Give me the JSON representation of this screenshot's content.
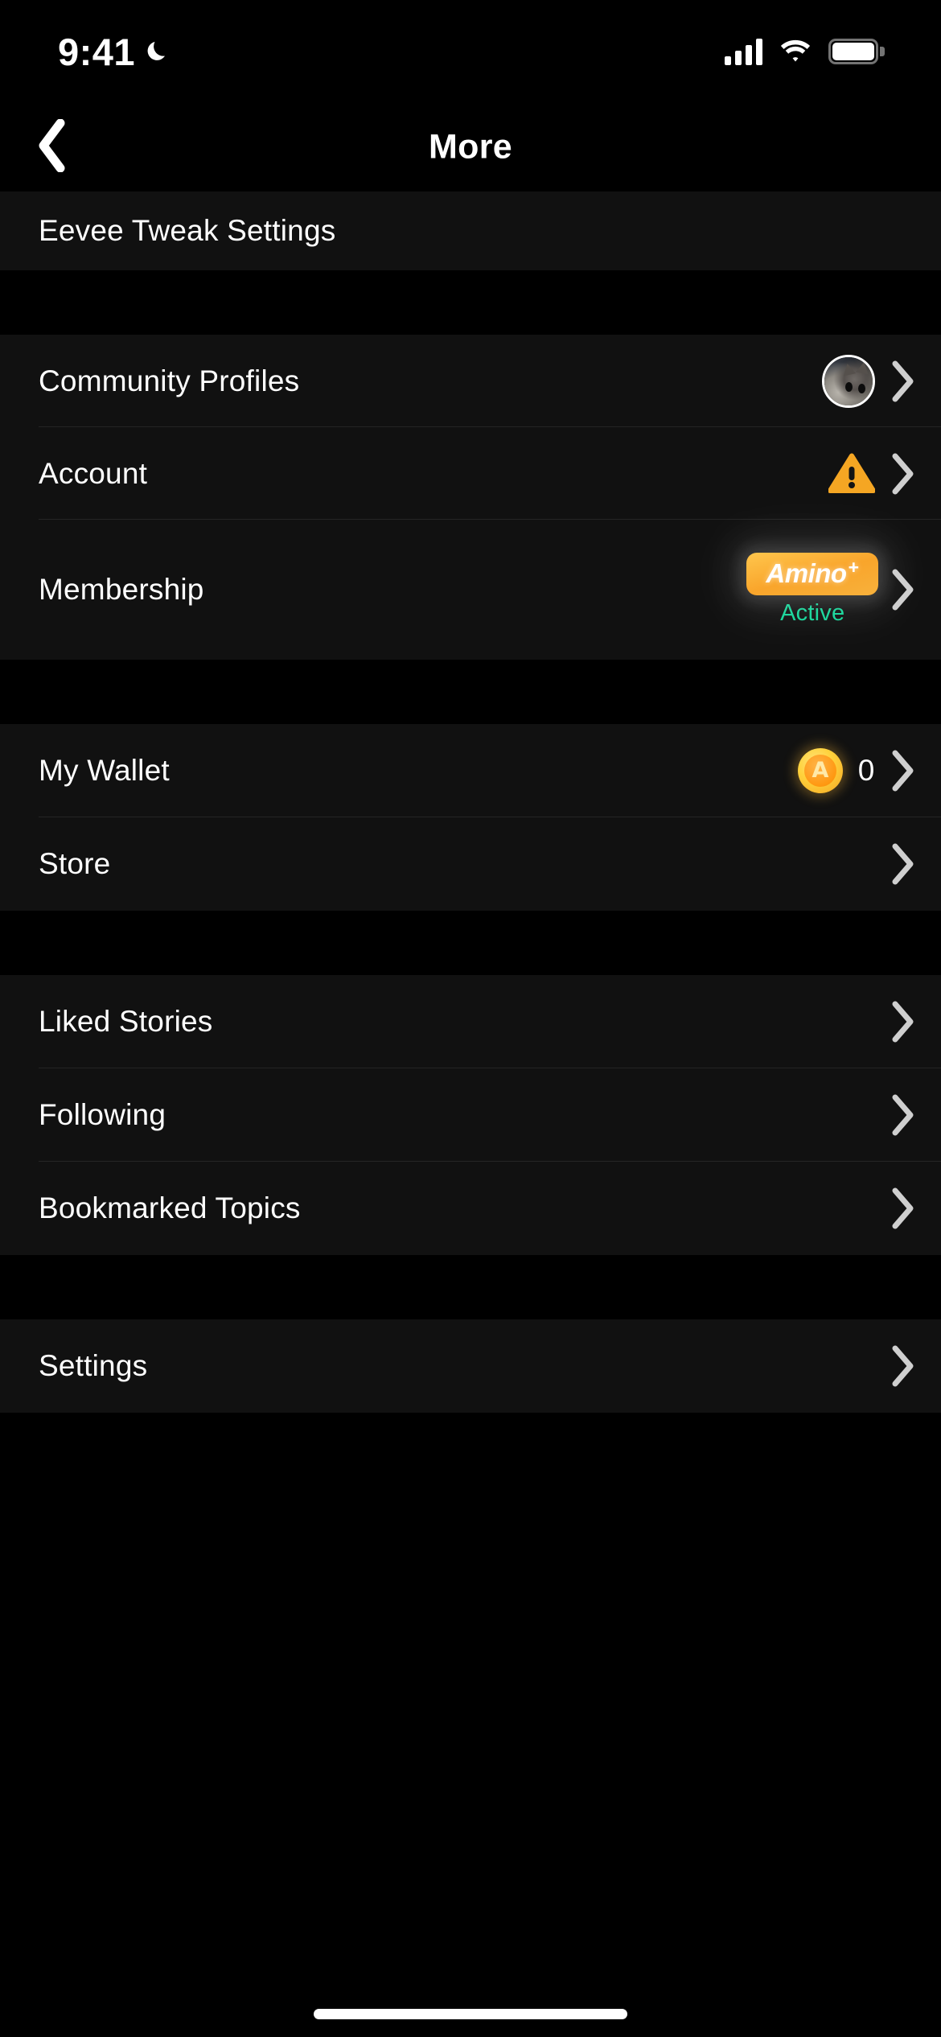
{
  "status_bar": {
    "time": "9:41",
    "dnd_icon": "crescent-moon-icon",
    "cellular_icon": "cellular-bars-icon",
    "wifi_icon": "wifi-icon",
    "battery_icon": "battery-full-icon"
  },
  "nav": {
    "back_icon": "chevron-left-icon",
    "title": "More"
  },
  "sections": [
    {
      "rows": [
        {
          "label": "Eevee Tweak Settings",
          "accessory": "none"
        }
      ]
    },
    {
      "rows": [
        {
          "label": "Community Profiles",
          "accessory": "avatar",
          "avatar_icon": "user-avatar-cat-photo"
        },
        {
          "label": "Account",
          "accessory": "warning",
          "warning_icon": "warning-triangle-icon"
        },
        {
          "label": "Membership",
          "accessory": "membership",
          "badge_text": "Amino",
          "badge_superscript": "+",
          "status_text": "Active"
        }
      ]
    },
    {
      "rows": [
        {
          "label": "My Wallet",
          "accessory": "coin",
          "coin_icon": "amino-coin-icon",
          "coin_glyph": "A",
          "coin_count": "0"
        },
        {
          "label": "Store",
          "accessory": "chevron"
        }
      ]
    },
    {
      "rows": [
        {
          "label": "Liked Stories",
          "accessory": "chevron"
        },
        {
          "label": "Following",
          "accessory": "chevron"
        },
        {
          "label": "Bookmarked Topics",
          "accessory": "chevron"
        }
      ]
    },
    {
      "rows": [
        {
          "label": "Settings",
          "accessory": "chevron"
        }
      ]
    }
  ],
  "colors": {
    "background": "#000000",
    "card": "#111111",
    "text_primary": "#ffffff",
    "separator": "rgba(255,255,255,0.085)",
    "accent_amber": "#f9a52b",
    "warning_amber": "#f5a623",
    "active_green": "#14d699",
    "coin_gold": "#ffd23c"
  },
  "home_indicator": "home-indicator-bar"
}
